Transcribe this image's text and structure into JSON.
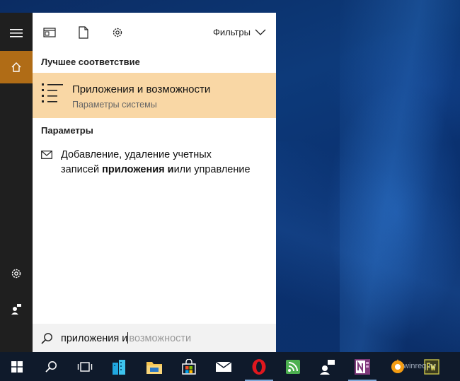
{
  "panel": {
    "filters_label": "Фильтры",
    "best_match_heading": "Лучшее соответствие",
    "best_match": {
      "title_bold": "Приложения и",
      "title_rest": " возможности",
      "subtitle": "Параметры системы",
      "icon": "apps-list-icon"
    },
    "settings_heading": "Параметры",
    "settings_result": {
      "line1": "Добавление, удаление учетных",
      "line2_pre": "записей ",
      "line2_bold": "приложения и",
      "line2_post": "или управление",
      "icon": "mail-icon"
    },
    "search": {
      "typed": "приложения и",
      "suggestion": "возможности"
    }
  },
  "watermark": "winreq.ru",
  "colors": {
    "accent": "#b06c16",
    "best_match_bg": "#f9d7a5",
    "rail_bg": "#1f1f1f",
    "taskbar_bg": "#0f1a2b"
  },
  "taskbar_apps": [
    "start-icon",
    "search-icon",
    "task-view-icon",
    "building-app-icon",
    "file-explorer-icon",
    "store-icon",
    "mail-icon",
    "opera-icon",
    "feed-reader-icon",
    "people-icon",
    "onenote-icon",
    "media-player-icon",
    "fireworks-icon"
  ]
}
